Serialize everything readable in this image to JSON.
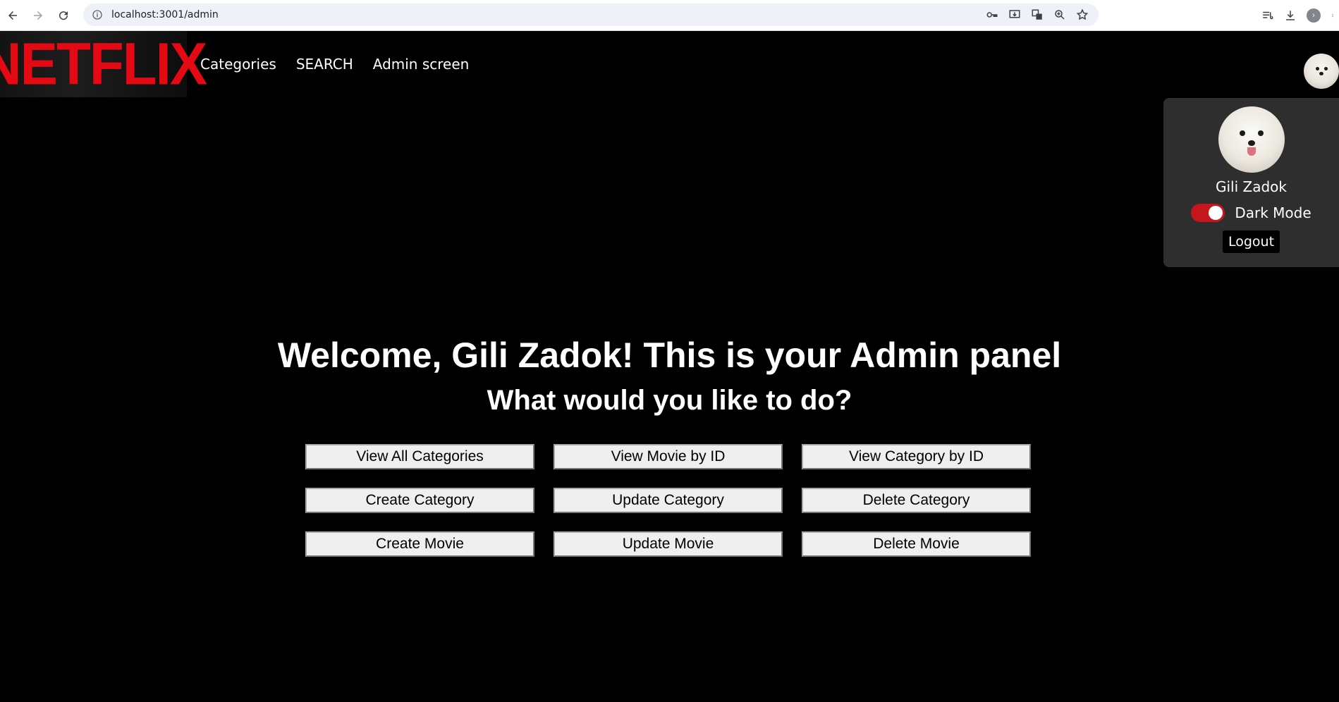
{
  "browser": {
    "url": "localhost:3001/admin"
  },
  "header": {
    "logo_text": "NETFLIX",
    "nav": [
      {
        "label": "Categories"
      },
      {
        "label": "SEARCH"
      },
      {
        "label": "Admin screen"
      }
    ]
  },
  "profile_menu": {
    "name": "Gili Zadok",
    "dark_mode_label": "Dark Mode",
    "dark_mode_on": true,
    "logout_label": "Logout"
  },
  "main": {
    "title": "Welcome, Gili Zadok! This is your Admin panel",
    "subtitle": "What would you like to do?",
    "buttons": [
      {
        "label": "View All Categories"
      },
      {
        "label": "View Movie by ID"
      },
      {
        "label": "View Category by ID"
      },
      {
        "label": "Create Category"
      },
      {
        "label": "Update Category"
      },
      {
        "label": "Delete Category"
      },
      {
        "label": "Create Movie"
      },
      {
        "label": "Update Movie"
      },
      {
        "label": "Delete Movie"
      }
    ]
  },
  "colors": {
    "brand_red": "#e50914",
    "toggle_red": "#c4161c",
    "menu_bg": "#2e2e2e",
    "page_bg": "#000000"
  }
}
